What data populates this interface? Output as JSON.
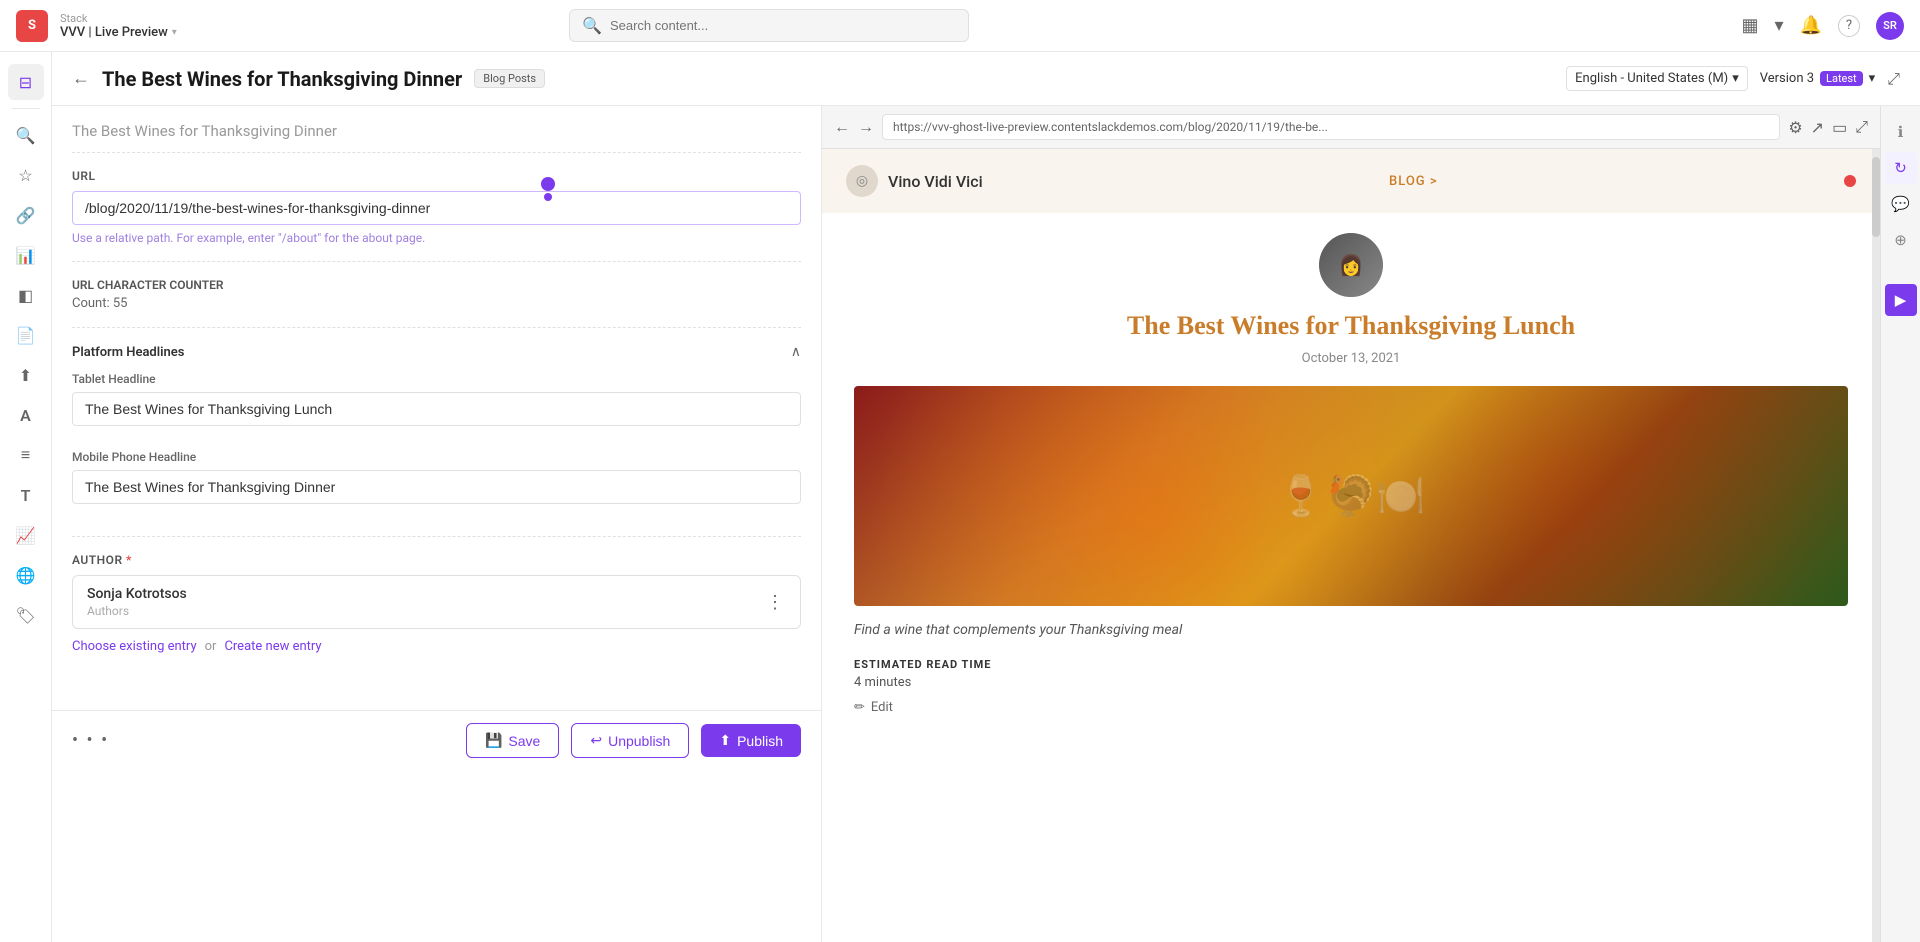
{
  "topbar": {
    "logo": "S",
    "stack_label": "Stack",
    "preview_label": "VVV | Live Preview",
    "search_placeholder": "Search content...",
    "user_initials": "SR"
  },
  "page_header": {
    "title": "The Best Wines for Thanksgiving Dinner",
    "badge": "Blog Posts",
    "locale": "English - United States (M)",
    "version_label": "Version 3",
    "version_tag": "Latest"
  },
  "edit_pane": {
    "entry_title": "The Best Wines for Thanksgiving Dinner",
    "url_label": "URL",
    "url_value": "/blog/2020/11/19/the-best-wines-for-thanksgiving-dinner",
    "url_hint": "Use a relative path. For example, enter \"/about\" for the about page.",
    "counter_label": "URL Character Counter",
    "counter_value": "Count: 55",
    "platform_headlines_label": "Platform Headlines",
    "tablet_headline_label": "Tablet Headline",
    "tablet_headline_value": "The Best Wines for Thanksgiving Lunch",
    "mobile_headline_label": "Mobile Phone Headline",
    "mobile_headline_value": "The Best Wines for Thanksgiving Dinner",
    "author_label": "Author",
    "author_name": "Sonja Kotrotsos",
    "author_role": "Authors",
    "choose_entry_label": "Choose existing entry",
    "or_label": "or",
    "create_entry_label": "Create new entry"
  },
  "bottom_toolbar": {
    "save_label": "Save",
    "unpublish_label": "Unpublish",
    "publish_label": "Publish"
  },
  "preview": {
    "url": "https://vvv-ghost-live-preview.contentslackdemos.com/blog/2020/11/19/the-be...",
    "site_name": "Vino Vidi Vici",
    "blog_nav": "BLOG >",
    "article_title": "The Best Wines for Thanksgiving Lunch",
    "article_date": "October 13, 2021",
    "excerpt": "Find a wine that complements your Thanksgiving meal",
    "read_time_label": "ESTIMATED READ TIME",
    "read_time": "4 minutes",
    "edit_label": "Edit"
  },
  "icons": {
    "back": "←",
    "search": "🔍",
    "bell": "🔔",
    "help": "?",
    "grid": "⊞",
    "layers": "◫",
    "link": "🔗",
    "chart": "📊",
    "doc": "📄",
    "font": "A",
    "menu": "≡",
    "t_icon": "T",
    "compass": "🌐",
    "tag": "🏷",
    "nav_back": "←",
    "nav_fwd": "→",
    "gear": "⚙",
    "external": "↗",
    "tablet": "▭",
    "expand": "⤢",
    "info": "ℹ",
    "chat": "💬",
    "adjust": "⊕",
    "star": "☆",
    "collapse": "∧",
    "chevron_down": "∨",
    "dots_vert": "⋮"
  }
}
